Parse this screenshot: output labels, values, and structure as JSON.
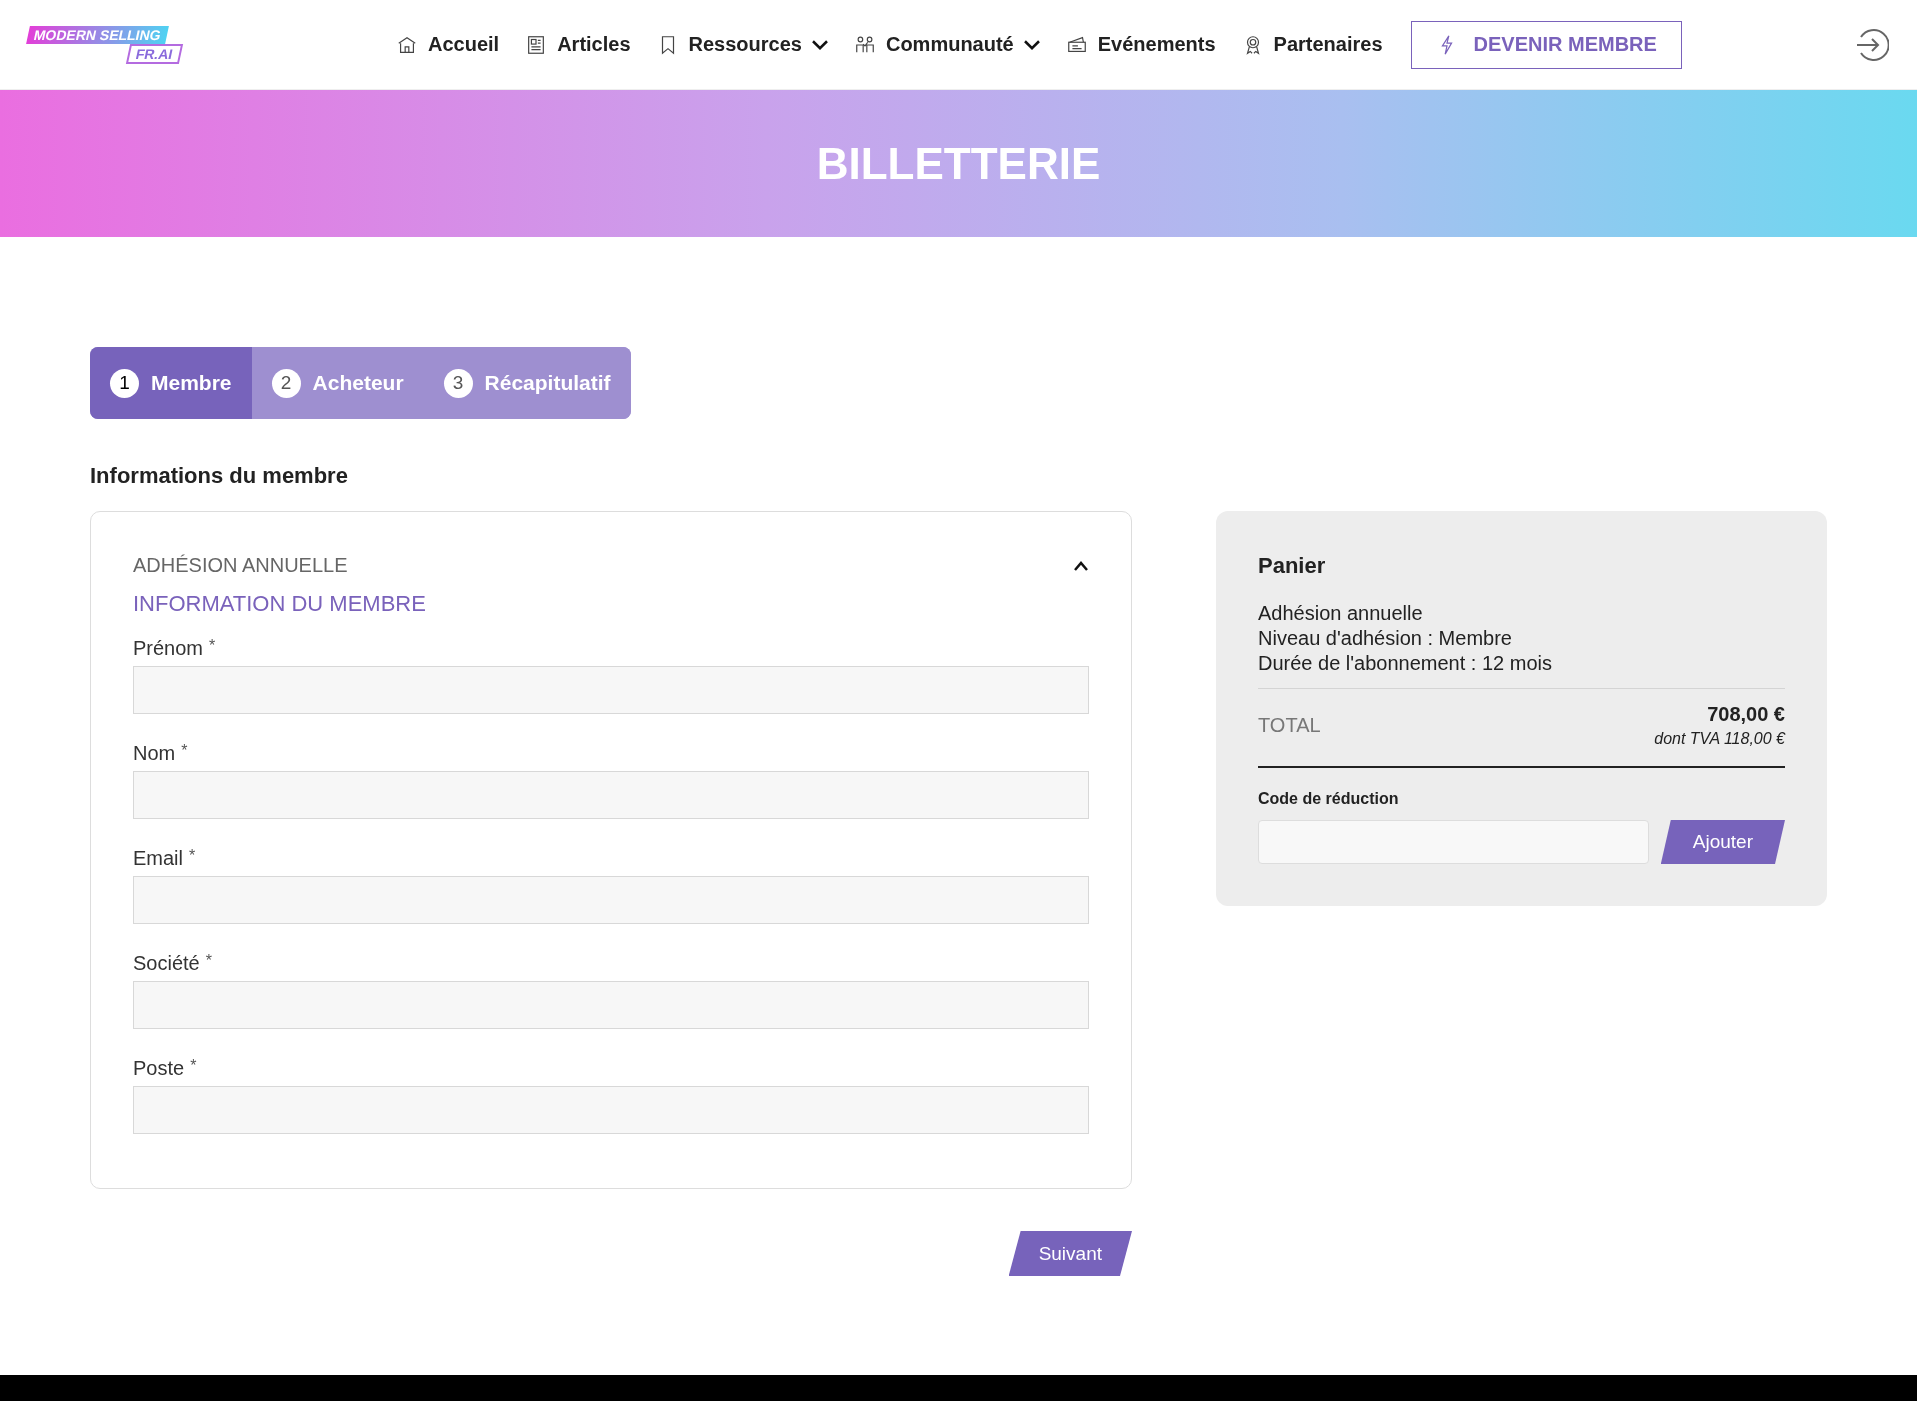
{
  "header": {
    "logo": {
      "line_1": "MODERN SELLING",
      "line_2": "FR.AI"
    },
    "nav": [
      {
        "label": "Accueil",
        "dropdown": false
      },
      {
        "label": "Articles",
        "dropdown": false
      },
      {
        "label": "Ressources",
        "dropdown": true
      },
      {
        "label": "Communauté",
        "dropdown": true
      },
      {
        "label": "Evénements",
        "dropdown": false
      },
      {
        "label": "Partenaires",
        "dropdown": false
      }
    ],
    "cta": "DEVENIR MEMBRE"
  },
  "banner": {
    "title": "BILLETTERIE"
  },
  "steps": [
    {
      "number": "1",
      "label": "Membre",
      "selected": true
    },
    {
      "number": "2",
      "label": "Acheteur",
      "selected": false
    },
    {
      "number": "3",
      "label": "Récapitulatif",
      "selected": false
    }
  ],
  "section_title": "Informations du membre",
  "form": {
    "product": "ADHÉSION ANNUELLE",
    "expanded": true,
    "heading": "INFORMATION DU MEMBRE",
    "fields": [
      {
        "label": "Prénom",
        "required_mark": "*"
      },
      {
        "label": "Nom",
        "required_mark": "*"
      },
      {
        "label": "Email",
        "required_mark": "*"
      },
      {
        "label": "Société",
        "required_mark": "*"
      },
      {
        "label": "Poste",
        "required_mark": "*"
      }
    ],
    "next_button": "Suivant"
  },
  "cart": {
    "title": "Panier",
    "lines": [
      "Adhésion annuelle",
      "Niveau d'adhésion : Membre",
      "Durée de l'abonnement : 12 mois"
    ],
    "total_label": "TOTAL",
    "total": "708,00 €",
    "vat": "dont TVA 118,00 €",
    "discount_label": "Code de réduction",
    "discount_button": "Ajouter"
  }
}
